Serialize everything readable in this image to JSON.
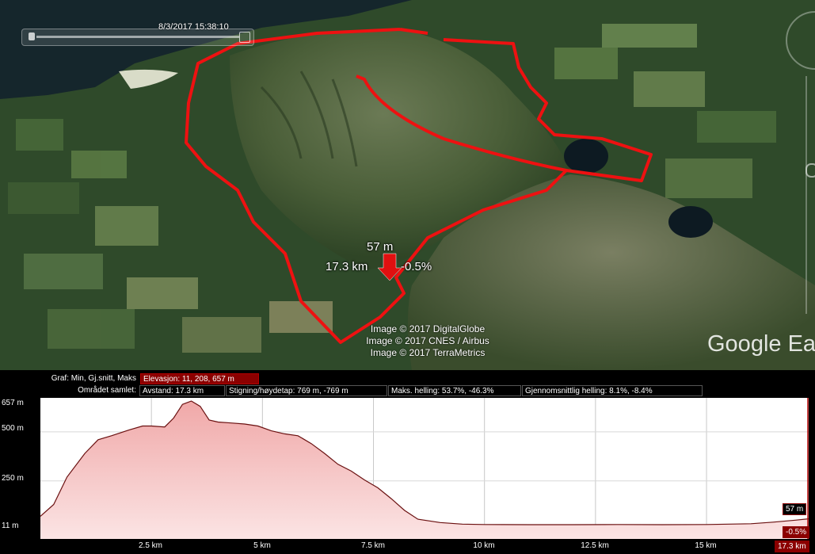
{
  "map": {
    "timestamp": "8/3/2017  15:38:10",
    "marker": {
      "elevation": "57 m",
      "distance": "17.3 km",
      "slope": "-0.5%"
    },
    "credits": [
      "Image © 2017 DigitalGlobe",
      "Image © 2017 CNES / Airbus",
      "Image © 2017 TerraMetrics"
    ],
    "brand": "Google Ear",
    "colors": {
      "track": "#ee1111",
      "fill": "#f3c8c8"
    }
  },
  "profile": {
    "graph_label": "Graf: Min, Gj.snitt, Maks",
    "elevation_stat": "Elevasjon: 11, 208, 657 m",
    "area_label": "Området samlet:",
    "distance_stat": "Avstand: 17.3 km",
    "climb_stat": "Stigning/høydetap: 769 m, -769 m",
    "max_slope_stat": "Maks. helling: 53.7%, -46.3%",
    "avg_slope_stat": "Gjennomsnittlig helling: 8.1%, -8.4%",
    "cursor_elevation": "57 m",
    "cursor_slope": "-0.5%",
    "cursor_distance": "17.3 km",
    "y_ticks": [
      "657 m",
      "500 m",
      "250 m",
      "11 m"
    ],
    "x_ticks": [
      "2.5 km",
      "5 km",
      "7.5 km",
      "10 km",
      "12.5 km",
      "15 km"
    ]
  },
  "chart_data": {
    "type": "area",
    "xlabel": "",
    "ylabel": "",
    "ylim": [
      11,
      657
    ],
    "xlim": [
      0,
      17.3
    ],
    "grid": true,
    "x": [
      0,
      0.3,
      0.6,
      1.0,
      1.3,
      1.6,
      2.0,
      2.3,
      2.5,
      2.8,
      3.0,
      3.2,
      3.4,
      3.6,
      3.8,
      4.0,
      4.3,
      4.6,
      4.9,
      5.2,
      5.5,
      5.8,
      6.1,
      6.4,
      6.7,
      7.0,
      7.3,
      7.6,
      7.9,
      8.2,
      8.5,
      9.0,
      9.5,
      10.0,
      11.0,
      12.0,
      13.0,
      14.0,
      15.0,
      16.0,
      16.5,
      17.0,
      17.3
    ],
    "y": [
      70,
      130,
      270,
      390,
      460,
      480,
      510,
      530,
      530,
      525,
      570,
      640,
      657,
      630,
      560,
      550,
      545,
      540,
      530,
      505,
      490,
      480,
      440,
      390,
      335,
      300,
      255,
      215,
      160,
      100,
      55,
      38,
      30,
      28,
      27,
      27,
      28,
      27,
      28,
      32,
      40,
      50,
      57
    ]
  }
}
